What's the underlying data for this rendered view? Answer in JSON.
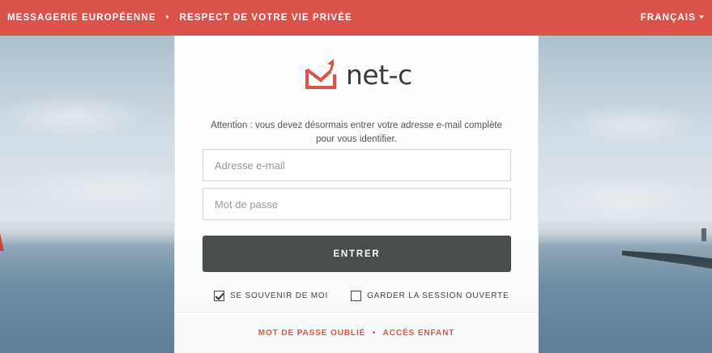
{
  "topbar": {
    "tagline_1": "MESSAGERIE EUROPÉENNE",
    "separator": "•",
    "tagline_2": "RESPECT DE VOTRE VIE PRIVÉE",
    "language": "FRANÇAIS"
  },
  "logo": {
    "text": "net-c",
    "icon": "envelope-arrow-icon"
  },
  "login": {
    "notice": "Attention : vous devez désormais entrer votre adresse e-mail complète pour vous identifier.",
    "email_placeholder": "Adresse e-mail",
    "email_value": "",
    "password_placeholder": "Mot de passe",
    "password_value": "",
    "submit_label": "ENTRER",
    "remember_label": "SE SOUVENIR DE MOI",
    "remember_checked": true,
    "keep_session_label": "GARDER LA SESSION OUVERTE",
    "keep_session_checked": false
  },
  "footer": {
    "forgot_password": "MOT DE PASSE OUBLIÉ",
    "separator": "•",
    "child_access": "ACCÈS ENFANT"
  },
  "colors": {
    "brand": "#d9534a",
    "button": "#4a4d4e"
  }
}
